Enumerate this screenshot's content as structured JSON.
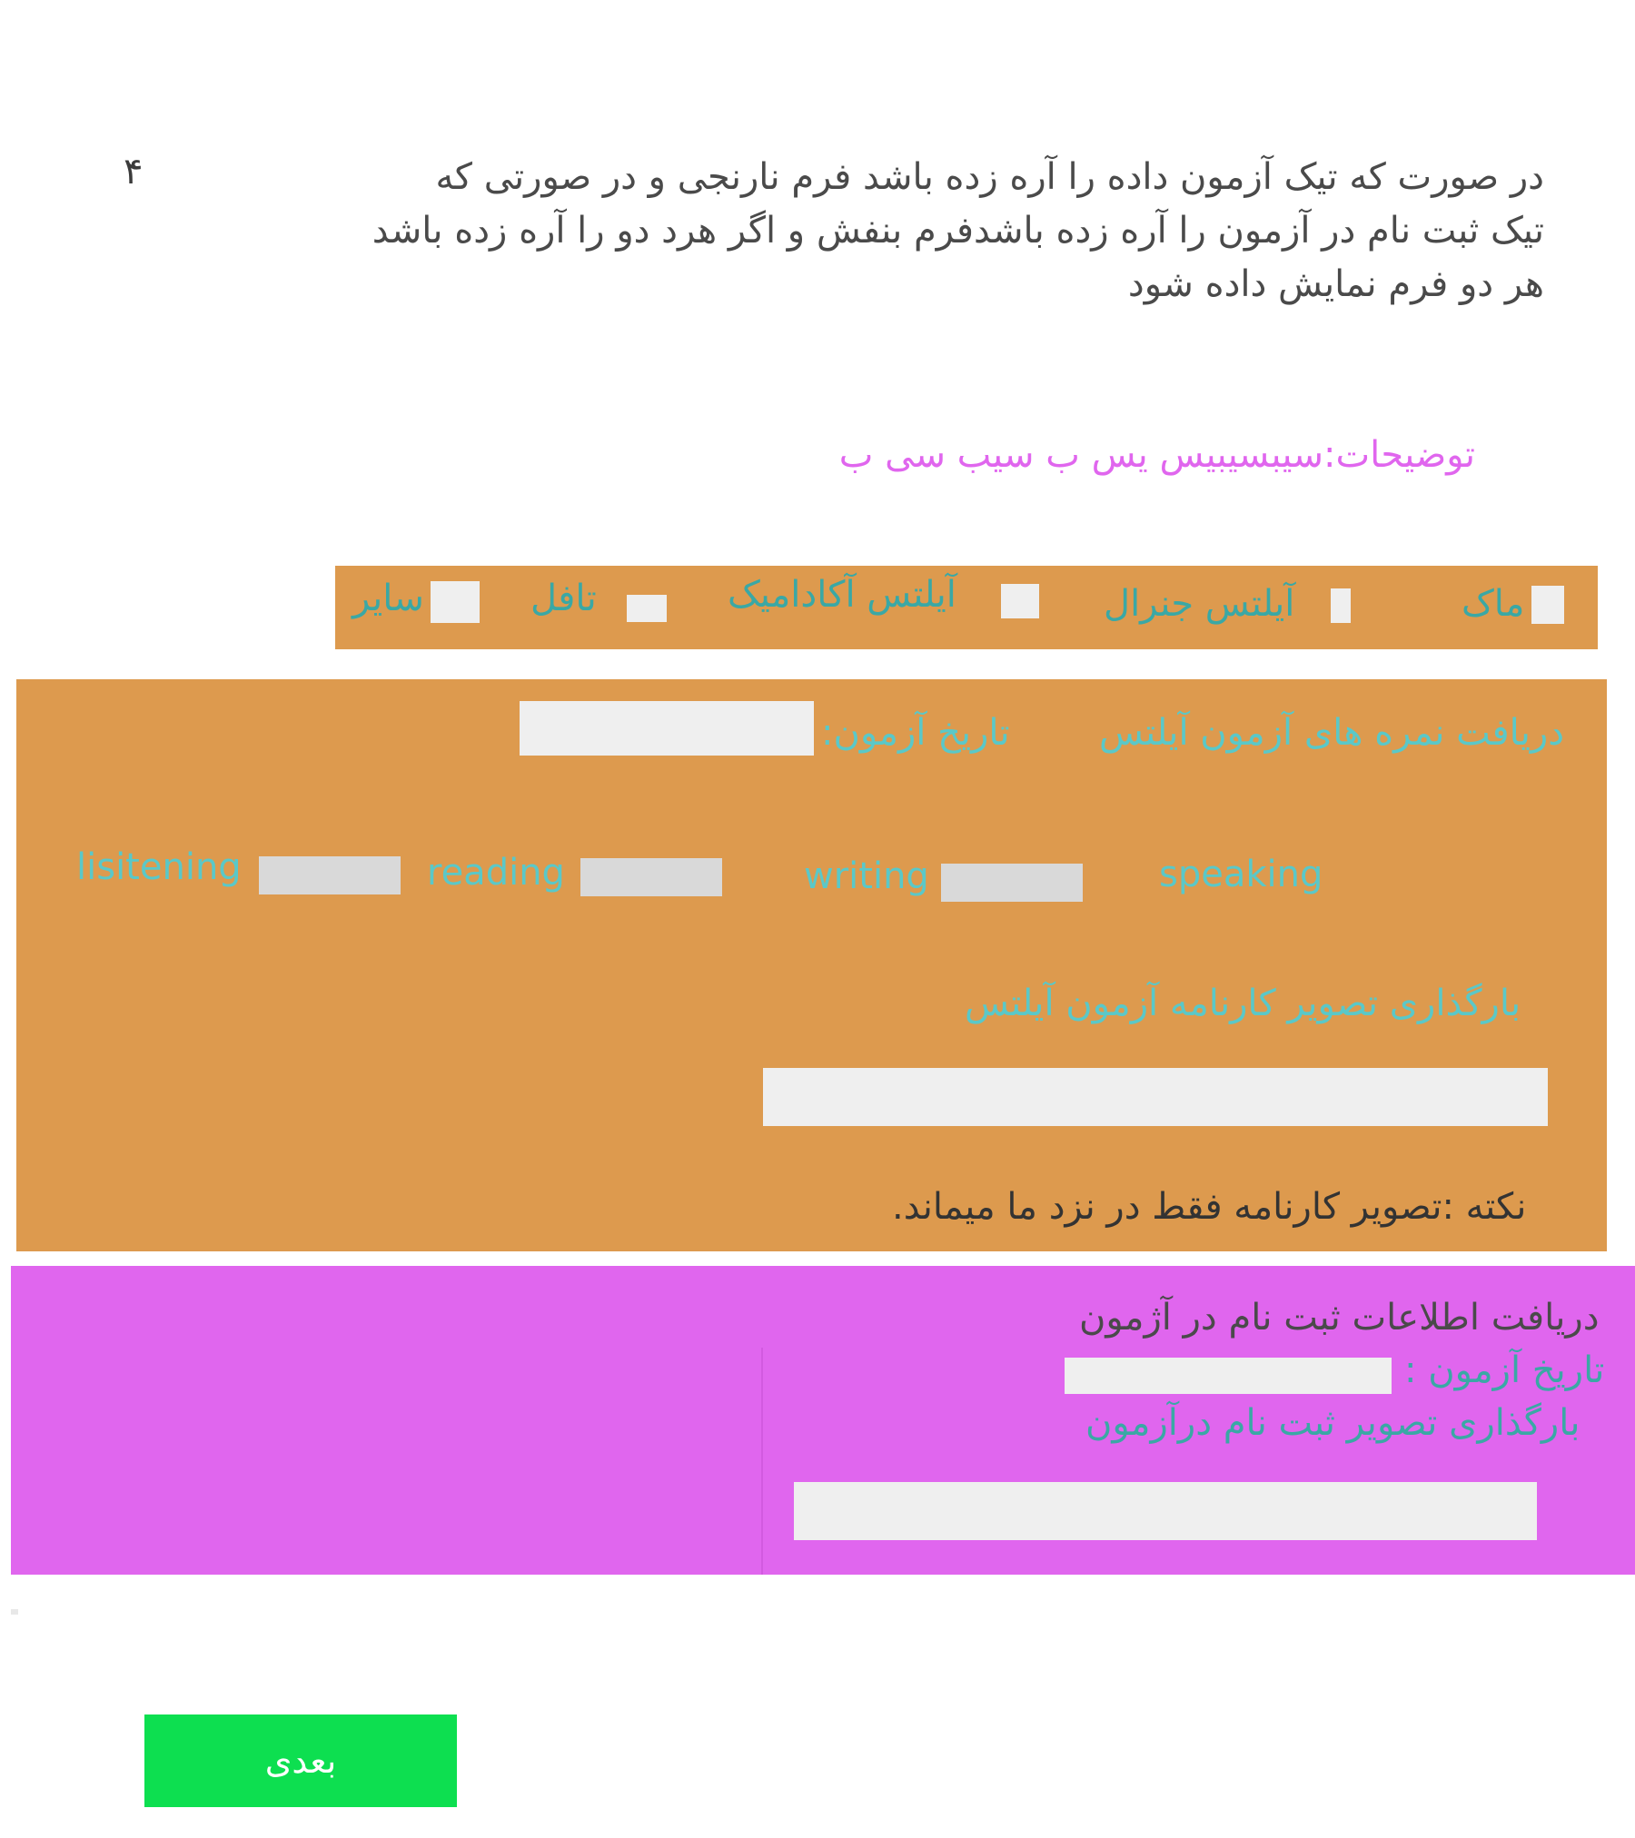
{
  "page_number": "۴",
  "instructions": {
    "line1": "در صورت که تیک آزمون  داده را آره  زده باشد فرم نارنجی و در صورتی که",
    "line2": "تیک ثبت نام در آزمون را آره زده باشدفرم بنفش و اگر هرد دو را آره زده باشد",
    "line3": "هر دو فرم نمایش داده شود"
  },
  "description": "توضیحات:سیبسیبیس  یس ب سیب سی ب",
  "exam_types": [
    {
      "label": "ماک"
    },
    {
      "label": "آیلتس جنرال"
    },
    {
      "label": "آیلتس آکادامیک"
    },
    {
      "label": "تافل"
    },
    {
      "label": "سایر"
    }
  ],
  "ielts_form": {
    "title": "دریافت نمره های آزمون آیلتس",
    "exam_date_label": "تاریخ آزمون:",
    "skills": {
      "speaking": "speaking",
      "writing": "writing",
      "reading": "reading",
      "listening": "lisitening"
    },
    "upload_label": "بارگذاری تصویر کارنامه آزمون آیلتس",
    "note": "نکته :تصویر کارنامه فقط در نزد ما میماند."
  },
  "registration_form": {
    "title": "دریافت اطلاعات ثبت نام در  آژمون",
    "exam_date_label": "تاریخ آزمون :",
    "upload_label": "بارگذاری تصویر ثبت نام درآزمون"
  },
  "next_button": "بعدی",
  "colors": {
    "orange": "#dd9a4e",
    "purple": "#e066ee",
    "teal_text": "#5ac8c8",
    "green_button": "#0ddf50"
  }
}
